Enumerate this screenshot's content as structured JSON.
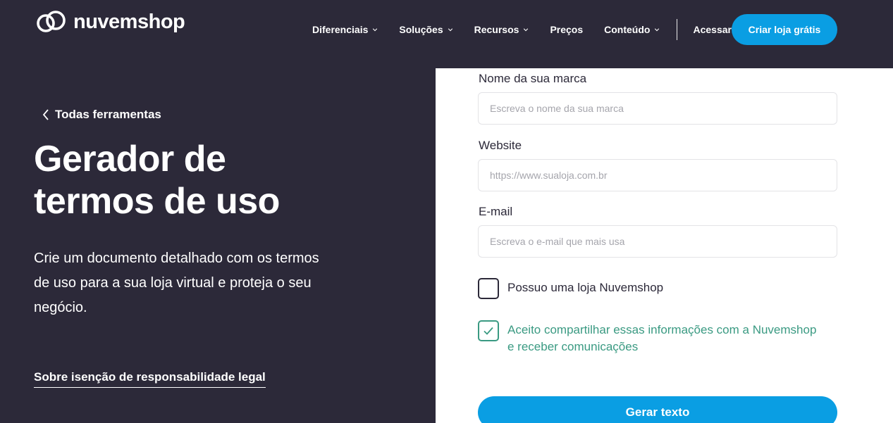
{
  "brand": {
    "name": "nuvemshop",
    "logo_icon": "cloud-rings-icon",
    "accent_color": "#0a9ee3",
    "dark_bg": "#2c2939",
    "success_color": "#3a9a82"
  },
  "nav": {
    "items": [
      {
        "label": "Diferenciais",
        "has_dropdown": true
      },
      {
        "label": "Soluções",
        "has_dropdown": true
      },
      {
        "label": "Recursos",
        "has_dropdown": true
      },
      {
        "label": "Preços",
        "has_dropdown": false
      },
      {
        "label": "Conteúdo",
        "has_dropdown": true
      }
    ],
    "login_label": "Acessar",
    "cta_label": "Criar loja grátis"
  },
  "hero": {
    "back_label": "Todas ferramentas",
    "title_line1": "Gerador de",
    "title_line2": "termos de uso",
    "description_line1": "Crie um documento detalhado com os termos",
    "description_line2": "de uso para a sua loja virtual e proteja o seu",
    "description_line3": "negócio.",
    "legal_link": "Sobre isenção de responsabilidade legal"
  },
  "form": {
    "brand_name": {
      "label": "Nome da sua marca",
      "placeholder": "Escreva o nome da sua marca",
      "value": ""
    },
    "website": {
      "label": "Website",
      "placeholder": "https://www.sualoja.com.br",
      "value": ""
    },
    "email": {
      "label": "E-mail",
      "placeholder": "Escreva o e-mail que mais usa",
      "value": ""
    },
    "has_store": {
      "label": "Possuo uma loja Nuvemshop",
      "checked": false
    },
    "consent": {
      "label_line1": "Aceito compartilhar essas informações com a Nuvemshop",
      "label_line2": "e receber comunicações",
      "checked": true
    },
    "submit_label": "Gerar texto"
  }
}
